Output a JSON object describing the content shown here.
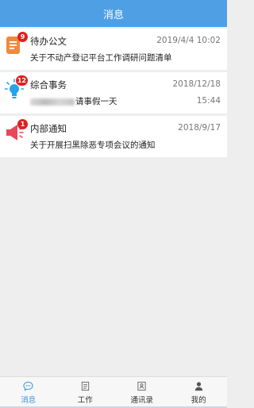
{
  "header": {
    "title": "消息"
  },
  "messages": [
    {
      "icon": "document-icon",
      "badge": "9",
      "title": "待办公文",
      "date": "2019/4/4 10:02",
      "time": "",
      "subtitle": "关于不动产登记平台工作调研问题清单"
    },
    {
      "icon": "lightbulb-icon",
      "badge": "12",
      "title": "综合事务",
      "date": "2018/12/18",
      "time": "15:44",
      "subtitle": "请事假一天"
    },
    {
      "icon": "megaphone-icon",
      "badge": "1",
      "title": "内部通知",
      "date": "2018/9/17",
      "time": "",
      "subtitle": "关于开展扫黑除恶专项会议的通知"
    }
  ],
  "tabs": [
    {
      "label": "消息",
      "icon": "chat-icon",
      "active": true
    },
    {
      "label": "工作",
      "icon": "clipboard-icon",
      "active": false
    },
    {
      "label": "通讯录",
      "icon": "contacts-icon",
      "active": false
    },
    {
      "label": "我的",
      "icon": "person-icon",
      "active": false
    }
  ],
  "colors": {
    "header": "#4f9fe5",
    "badge": "#e02020",
    "active_tab": "#3a93e0",
    "doc_icon": "#f08a3c",
    "bulb_icon": "#29a3e8",
    "speaker_icon": "#e8475a"
  }
}
